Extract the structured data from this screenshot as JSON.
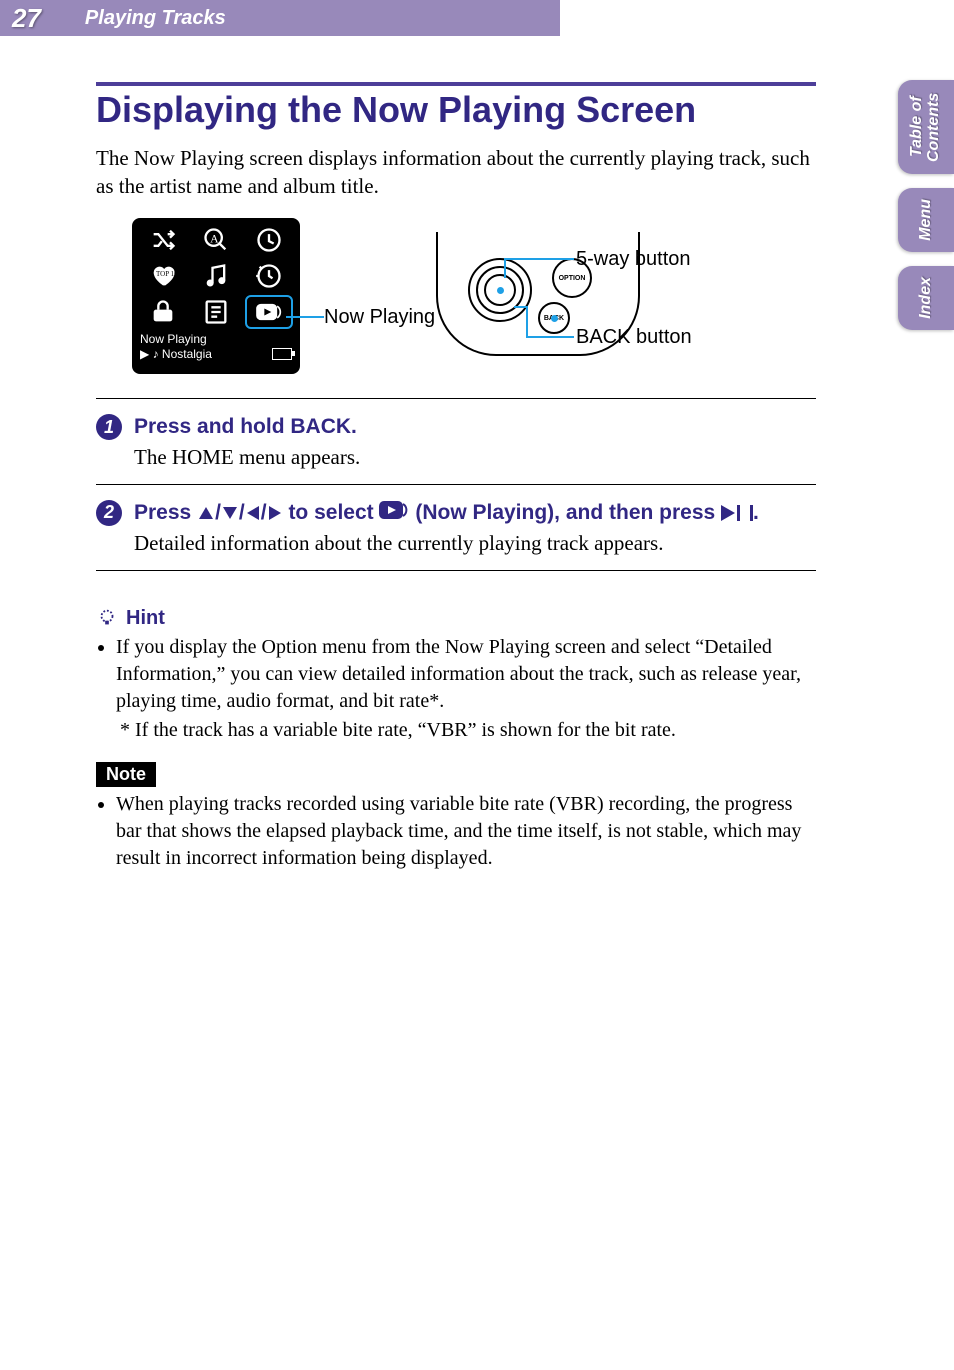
{
  "header": {
    "page_number": "27",
    "section": "Playing Tracks"
  },
  "tabs": {
    "toc": "Table of\nContents",
    "menu": "Menu",
    "index": "Index"
  },
  "title": "Displaying the Now Playing Screen",
  "intro": "The Now Playing screen displays information about the currently playing track, such as the artist name and album title.",
  "figure": {
    "device": {
      "now_playing_label": "Now Playing",
      "now_playing_row": "Now Playing",
      "track": "Nostalgia"
    },
    "controller": {
      "option": "OPTION",
      "back": "BACK",
      "five_way_label": "5-way button",
      "back_label": "BACK button"
    }
  },
  "steps": [
    {
      "num": "1",
      "head": "Press and hold BACK.",
      "body": "The HOME menu appears."
    },
    {
      "num": "2",
      "head_pre": "Press ",
      "head_mid": " to select ",
      "head_post": " (Now Playing), and then press ",
      "head_end": ".",
      "body": "Detailed information about the currently playing track appears."
    }
  ],
  "hint": {
    "label": "Hint",
    "bullet": "If you display the Option menu from the Now Playing screen and select “Detailed Information,” you can view detailed information about the track, such as release year, playing time, audio format, and bit rate*.",
    "footnote": "*  If the track has a variable bite rate, “VBR” is shown for the bit rate."
  },
  "note": {
    "label": "Note",
    "bullet": "When playing tracks recorded using variable bite rate (VBR) recording, the progress bar that shows the elapsed playback time, and the time itself, is not stable, which may result in incorrect information being displayed."
  }
}
